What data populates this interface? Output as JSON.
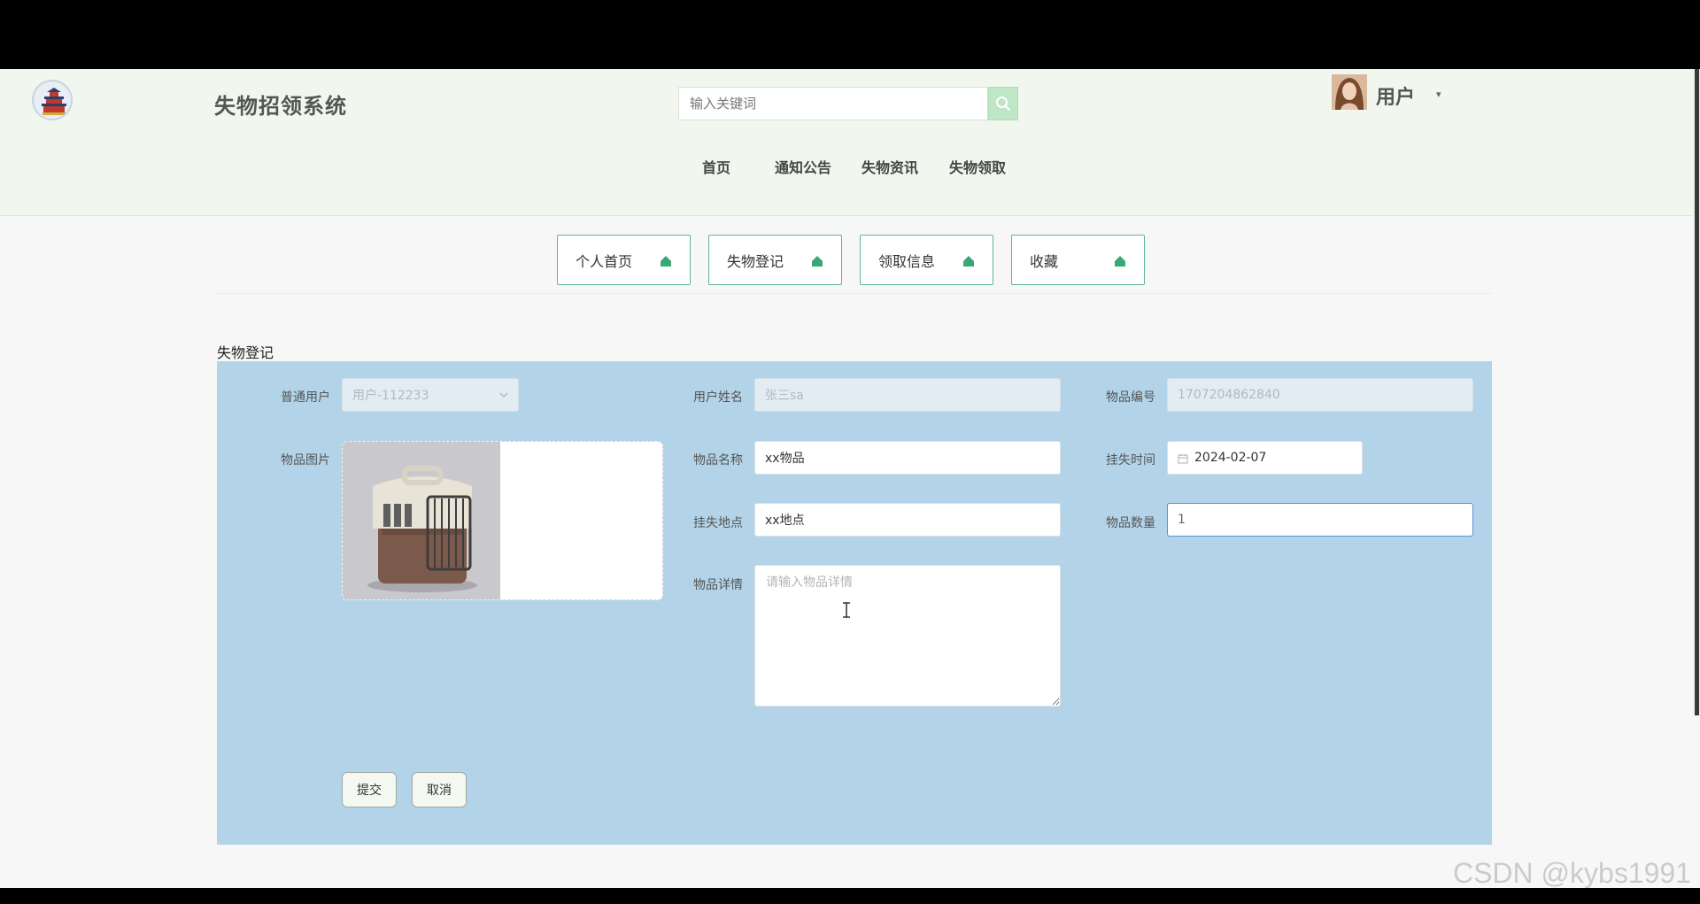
{
  "header": {
    "site_title": "失物招领系统",
    "search_placeholder": "输入关键词",
    "user_label": "用户",
    "caret": "▾"
  },
  "nav": [
    "首页",
    "通知公告",
    "失物资讯",
    "失物领取"
  ],
  "tabs": [
    "个人首页",
    "失物登记",
    "领取信息",
    "收藏"
  ],
  "section_title": "失物登记",
  "form": {
    "user_label": "普通用户",
    "user_value": "用户-112233",
    "username_label": "用户姓名",
    "username_value": "张三sa",
    "item_no_label": "物品编号",
    "item_no_value": "1707204862840",
    "image_label": "物品图片",
    "item_name_label": "物品名称",
    "item_name_value": "xx物品",
    "lost_time_label": "挂失时间",
    "lost_time_value": "2024-02-07",
    "lost_place_label": "挂失地点",
    "lost_place_value": "xx地点",
    "qty_label": "物品数量",
    "qty_value": "1",
    "detail_label": "物品详情",
    "detail_placeholder": "请输入物品详情",
    "submit_label": "提交",
    "cancel_label": "取消"
  },
  "watermark": "CSDN @kybs1991",
  "colors": {
    "header_bg": "#f1f7ef",
    "form_panel_bg": "#b3d4e8",
    "tab_border": "#5fb596",
    "accent_green": "#3aa874"
  }
}
